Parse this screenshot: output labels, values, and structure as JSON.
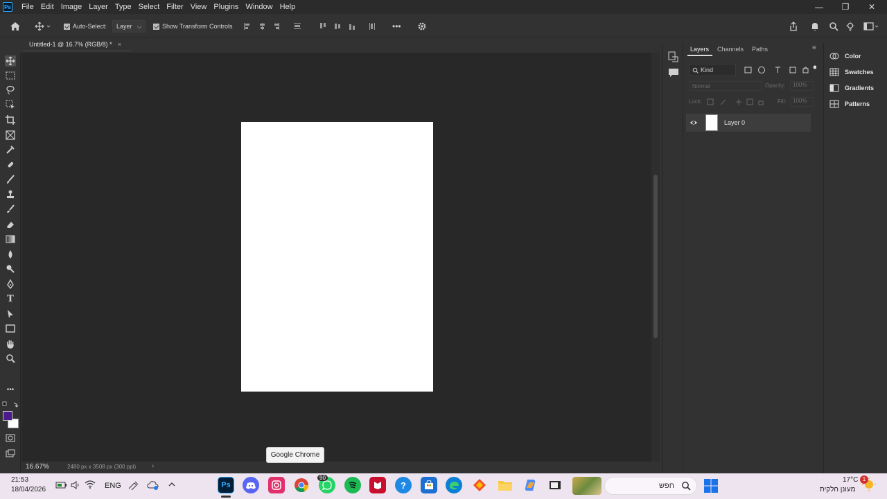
{
  "app": {
    "logo": "Ps",
    "menu": [
      "File",
      "Edit",
      "Image",
      "Layer",
      "Type",
      "Select",
      "Filter",
      "View",
      "Plugins",
      "Window",
      "Help"
    ],
    "window_controls": {
      "minimize": "—",
      "restore": "❐",
      "close": "✕"
    }
  },
  "options_bar": {
    "auto_select_label": "Auto-Select:",
    "auto_select_checked": true,
    "auto_select_target": "Layer",
    "show_transform_label": "Show Transform Controls",
    "show_transform_checked": true,
    "more_label": "•••"
  },
  "document": {
    "tab_title": "Untitled-1 @ 16.7% (RGB/8) *",
    "close_glyph": "×",
    "zoom": "16.67%",
    "doc_info": "2480 px x 3508 px (300 ppi)",
    "status_arrow": "›"
  },
  "tools": [
    "move-tool-icon",
    "marquee-tool-icon",
    "lasso-tool-icon",
    "object-select-tool-icon",
    "crop-tool-icon",
    "frame-tool-icon",
    "eyedropper-tool-icon",
    "healing-brush-icon",
    "brush-tool-icon",
    "clone-stamp-icon",
    "history-brush-icon",
    "eraser-tool-icon",
    "gradient-tool-icon",
    "blur-tool-icon",
    "dodge-tool-icon",
    "pen-tool-icon",
    "type-tool-icon",
    "path-select-icon",
    "rectangle-tool-icon",
    "hand-tool-icon",
    "zoom-tool-icon",
    "edit-toolbar-icon"
  ],
  "colors": {
    "foreground": "#4b1a8c",
    "background": "#ffffff",
    "canvas": "#ffffff",
    "pasteboard": "#282828"
  },
  "layers_panel": {
    "tabs": [
      "Layers",
      "Channels",
      "Paths"
    ],
    "active_tab": "Layers",
    "filter_kind": "Kind",
    "blend_mode": "Normal",
    "opacity_label": "Opacity:",
    "opacity_value": "100%",
    "lock_label": "Lock:",
    "fill_label": "Fill:",
    "fill_value": "100%",
    "layers": [
      {
        "name": "Layer 0",
        "visible": true
      }
    ]
  },
  "right_panels": [
    "Color",
    "Swatches",
    "Gradients",
    "Patterns"
  ],
  "tooltip": "Google Chrome",
  "taskbar": {
    "time": "21:53",
    "date": "18/04/2026",
    "language": "ENG",
    "search_placeholder": "חפש",
    "weather_temp": "17°C",
    "weather_desc": "מעונן חלקית",
    "notification_count": "1",
    "whatsapp_badge": "90",
    "apps": [
      "photoshop",
      "discord",
      "instagram",
      "chrome",
      "whatsapp",
      "spotify",
      "mcafee",
      "help",
      "store",
      "edge",
      "office",
      "file-explorer",
      "copilot",
      "terminal"
    ]
  }
}
